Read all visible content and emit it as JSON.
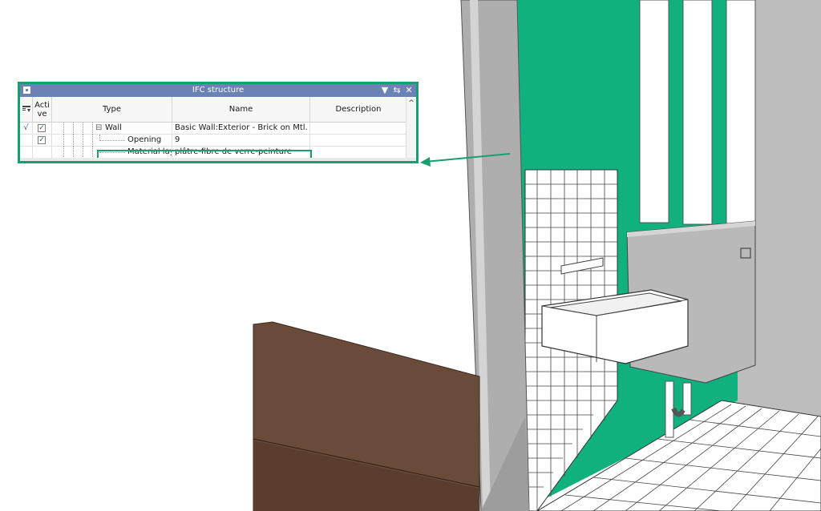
{
  "panel": {
    "title": "IFC structure",
    "menu_glyph": "▼",
    "dock_glyph": "⇆",
    "close_glyph": "✕",
    "pin_icon": "pin-icon",
    "columns": {
      "filter_icon": "filter-columns-icon",
      "active_line1": "Acti",
      "active_line2": "ve",
      "type": "Type",
      "name": "Name",
      "description": "Description"
    },
    "scroll_up_glyph": "^",
    "rows": [
      {
        "mark": "√",
        "active": "✓",
        "expander": "⊟",
        "type": "Wall",
        "name": "Basic Wall:Exterior - Brick on Mtl. ...",
        "description": ""
      },
      {
        "mark": "",
        "active": "✓",
        "expander": "",
        "type": "Opening",
        "name": "9",
        "description": ""
      },
      {
        "mark": "",
        "active": "",
        "expander": "",
        "type": "Material layer",
        "name": "plâtre-fibre de verre-peinture",
        "description": ""
      }
    ]
  },
  "colors": {
    "accent_green": "#1a9e6e",
    "titlebar_blue": "#6c81b6",
    "wall_green": "#10b07f",
    "floor_brown": "#6a4a38"
  }
}
